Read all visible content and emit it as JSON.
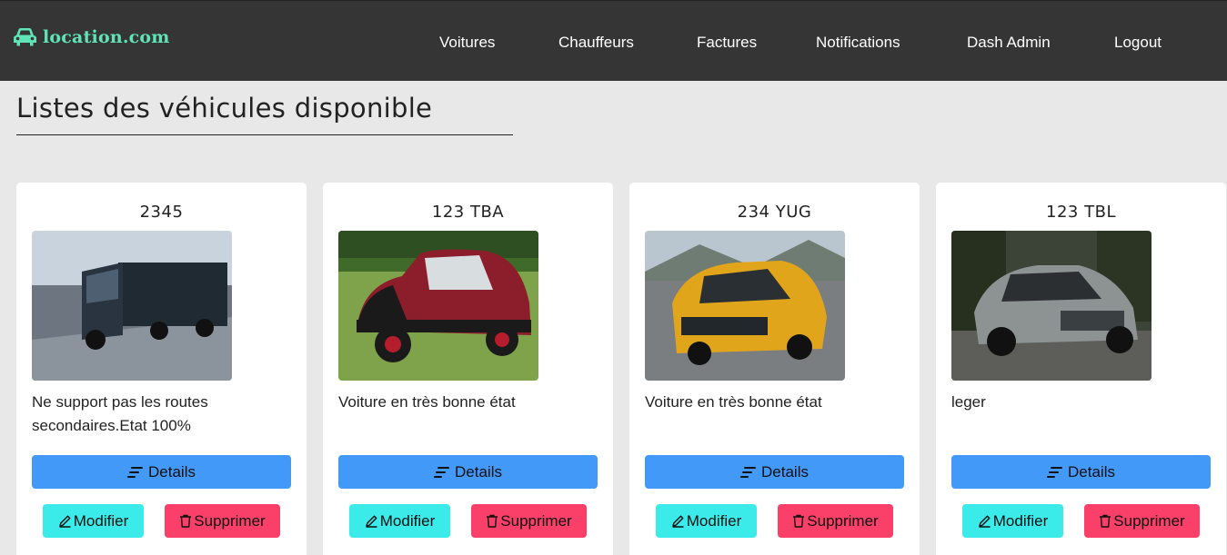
{
  "nav": {
    "brand": "location.com",
    "links": [
      "Voitures",
      "Chauffeurs",
      "Factures",
      "Notifications",
      "Dash Admin",
      "Logout"
    ]
  },
  "page": {
    "title": "Listes des véhicules disponible"
  },
  "vehicles": [
    {
      "code": "2345",
      "description": "Ne support pas les routes secondaires.Etat 100%",
      "image": "truck-photo"
    },
    {
      "code": "123 TBA",
      "description": "Voiture en très bonne état",
      "image": "classic-car-photo"
    },
    {
      "code": "234 YUG",
      "description": "Voiture en très bonne état",
      "image": "yellow-hatchback-photo"
    },
    {
      "code": "123 TBL",
      "description": "leger",
      "image": "grey-suv-photo"
    }
  ],
  "buttons": {
    "details": "Details",
    "edit": "Modifier",
    "delete": "Supprimer"
  },
  "icons": {
    "brand": "car-icon",
    "details": "sort-lines-icon",
    "edit": "pencil-icon",
    "delete": "trash-icon"
  },
  "colors": {
    "navbar": "#353535",
    "brand": "#5fe3b7",
    "details": "#4399f7",
    "edit": "#3bebe9",
    "delete": "#fa3f69",
    "background": "#e9e8e9"
  }
}
